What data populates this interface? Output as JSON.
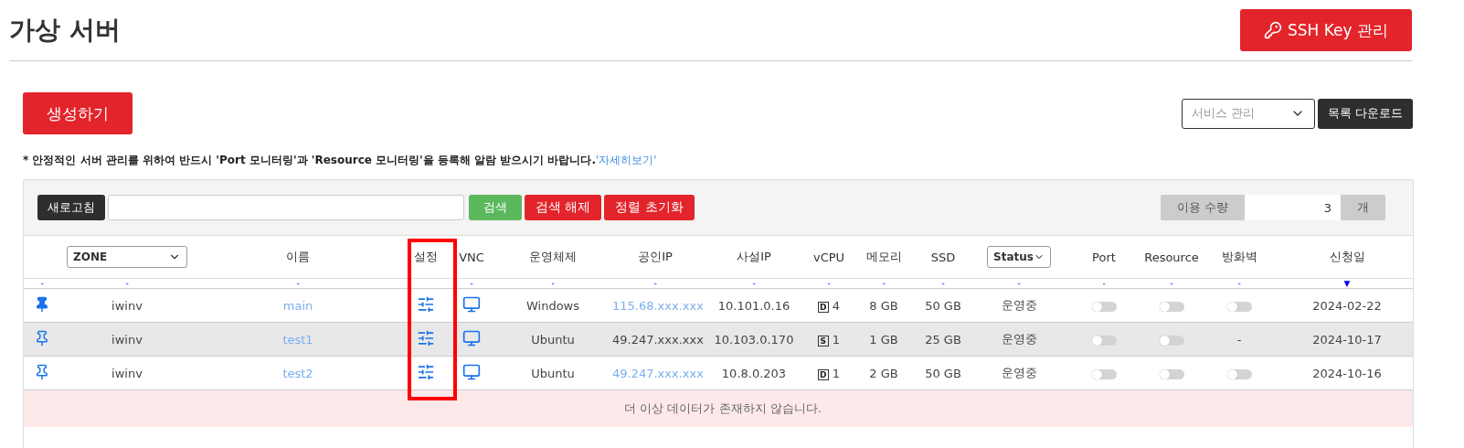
{
  "page": {
    "title": "가상 서버",
    "ssh_button": "SSH Key 관리"
  },
  "actions": {
    "create_button": "생성하기",
    "service_select": {
      "placeholder": "서비스 관리"
    },
    "download_button": "목록 다운로드"
  },
  "notice": {
    "text": "* 안정적인 서버 관리를 위하여 반드시 'Port 모니터링'과 'Resource 모니터링'을 등록해 알람 받으시기 바랍니다.",
    "link": "'자세히보기'"
  },
  "toolbar": {
    "refresh_button": "새로고침",
    "search_button": "검색",
    "clear_button": "검색 해제",
    "reset_sort_button": "정렬 초기화",
    "usage_label": "이용 수량",
    "usage_value": "3",
    "usage_unit": "개"
  },
  "columns": [
    {
      "kind": "text",
      "sort": "-",
      "highlighted": false
    },
    {
      "kind": "select",
      "label": "ZONE",
      "sort": "-",
      "highlighted": false
    },
    {
      "kind": "text",
      "label": "이름",
      "sort": "-",
      "highlighted": false
    },
    {
      "kind": "text",
      "label": "설정",
      "highlighted": true
    },
    {
      "kind": "text",
      "label": "VNC",
      "sort": "-",
      "highlighted": false
    },
    {
      "kind": "text",
      "label": "운영체제",
      "sort": "-",
      "highlighted": false
    },
    {
      "kind": "text",
      "label": "공인IP",
      "sort": "-",
      "highlighted": false
    },
    {
      "kind": "text",
      "label": "사설IP",
      "sort": "-",
      "highlighted": false
    },
    {
      "kind": "text",
      "label": "vCPU",
      "sort": "-",
      "highlighted": false
    },
    {
      "kind": "text",
      "label": "메모리",
      "sort": "-",
      "highlighted": false
    },
    {
      "kind": "text",
      "label": "SSD",
      "sort": "-",
      "highlighted": false
    },
    {
      "kind": "select",
      "label": "Status",
      "sort": "-",
      "highlighted": false
    },
    {
      "kind": "text",
      "label": "Port",
      "sort": "-",
      "highlighted": false
    },
    {
      "kind": "text",
      "label": "Resource",
      "sort": "-",
      "highlighted": false
    },
    {
      "kind": "text",
      "label": "방화벽",
      "sort": "-",
      "highlighted": false
    },
    {
      "kind": "text",
      "label": "신청일",
      "sort": "▼",
      "highlighted": false
    }
  ],
  "rows": [
    {
      "selected": false,
      "pinned": true,
      "zone": "iwinv",
      "name": "main",
      "os": "Windows",
      "public_ip": "115.68.xxx.xxx",
      "public_ip_link": true,
      "private_ip": "10.101.0.16",
      "vcpu_type": "D",
      "vcpu": "4",
      "memory": "8 GB",
      "ssd": "50 GB",
      "status": "운영중",
      "port": {
        "kind": "toggle",
        "on": false
      },
      "resource": {
        "kind": "toggle",
        "on": false
      },
      "firewall": {
        "kind": "toggle",
        "on": false
      },
      "date": "2024-02-22"
    },
    {
      "selected": true,
      "pinned": false,
      "zone": "iwinv",
      "name": "test1",
      "os": "Ubuntu",
      "public_ip": "49.247.xxx.xxx",
      "public_ip_link": false,
      "private_ip": "10.103.0.170",
      "vcpu_type": "S",
      "vcpu": "1",
      "memory": "1 GB",
      "ssd": "25 GB",
      "status": "운영중",
      "port": {
        "kind": "toggle",
        "on": false
      },
      "resource": {
        "kind": "toggle",
        "on": false
      },
      "firewall": {
        "kind": "text",
        "text": "-"
      },
      "date": "2024-10-17"
    },
    {
      "selected": false,
      "pinned": false,
      "zone": "iwinv",
      "name": "test2",
      "os": "Ubuntu",
      "public_ip": "49.247.xxx.xxx",
      "public_ip_link": true,
      "private_ip": "10.8.0.203",
      "vcpu_type": "D",
      "vcpu": "1",
      "memory": "2 GB",
      "ssd": "50 GB",
      "status": "운영중",
      "port": {
        "kind": "toggle",
        "on": false
      },
      "resource": {
        "kind": "toggle",
        "on": false
      },
      "firewall": {
        "kind": "toggle",
        "on": false
      },
      "date": "2024-10-16"
    }
  ],
  "empty_message": "더 이상 데이터가 존재하지 않습니다."
}
